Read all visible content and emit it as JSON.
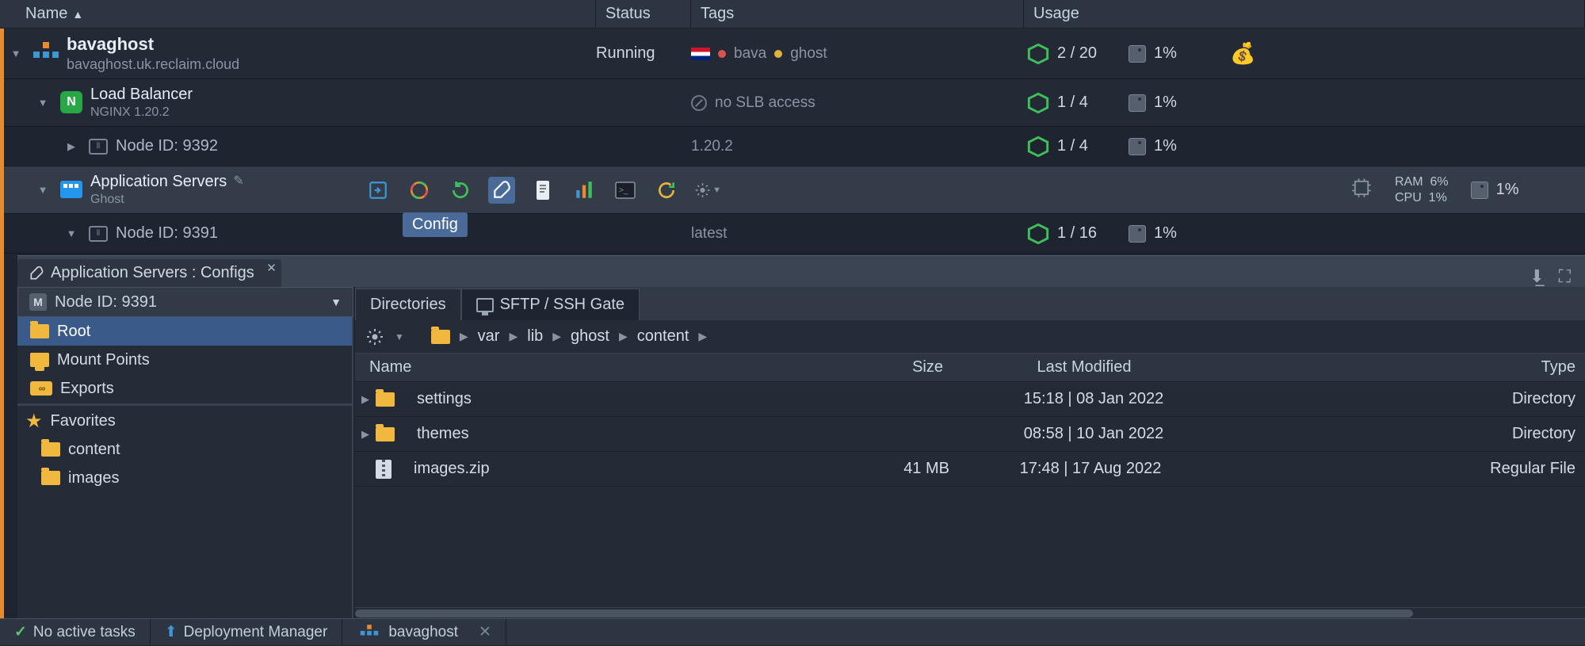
{
  "headers": {
    "name": "Name",
    "status": "Status",
    "tags": "Tags",
    "usage": "Usage"
  },
  "env": {
    "title": "bavaghost",
    "domain": "bavaghost.uk.reclaim.cloud",
    "status": "Running",
    "tags": [
      "bava",
      "ghost"
    ],
    "cloudlets": "2 / 20",
    "disk": "1%"
  },
  "lb": {
    "title": "Load Balancer",
    "version": "NGINX 1.20.2",
    "warn": "no SLB access",
    "cloudlets": "1 / 4",
    "disk": "1%",
    "node": "Node ID: 9392",
    "nodeVer": "1.20.2",
    "nodeCloud": "1 / 4",
    "nodeDisk": "1%"
  },
  "app": {
    "title": "Application Servers",
    "stack": "Ghost",
    "ramLbl": "RAM",
    "ramVal": "6%",
    "cpuLbl": "CPU",
    "cpuVal": "1%",
    "disk": "1%",
    "node": "Node ID: 9391",
    "nodeVer": "latest",
    "nodeCloud": "1 / 16",
    "nodeDisk": "1%"
  },
  "tooltip": "Config",
  "panelTab": "Application Servers : Configs",
  "nodeDropdown": "Node ID: 9391",
  "sidebar": {
    "root": "Root",
    "mount": "Mount Points",
    "exports": "Exports",
    "fav": "Favorites",
    "content": "content",
    "images": "images"
  },
  "rtabs": {
    "dir": "Directories",
    "sftp": "SFTP / SSH Gate"
  },
  "breadcrumb": [
    "var",
    "lib",
    "ghost",
    "content"
  ],
  "fileHdr": {
    "name": "Name",
    "size": "Size",
    "mod": "Last Modified",
    "type": "Type"
  },
  "files": [
    {
      "name": "settings",
      "size": "",
      "mod": "15:18 | 08 Jan 2022",
      "type": "Directory",
      "dir": true
    },
    {
      "name": "themes",
      "size": "",
      "mod": "08:58 | 10 Jan 2022",
      "type": "Directory",
      "dir": true
    },
    {
      "name": "images.zip",
      "size": "41 MB",
      "mod": "17:48 | 17 Aug 2022",
      "type": "Regular File",
      "dir": false
    }
  ],
  "statusbar": {
    "tasks": "No active tasks",
    "deploy": "Deployment Manager",
    "env": "bavaghost"
  }
}
